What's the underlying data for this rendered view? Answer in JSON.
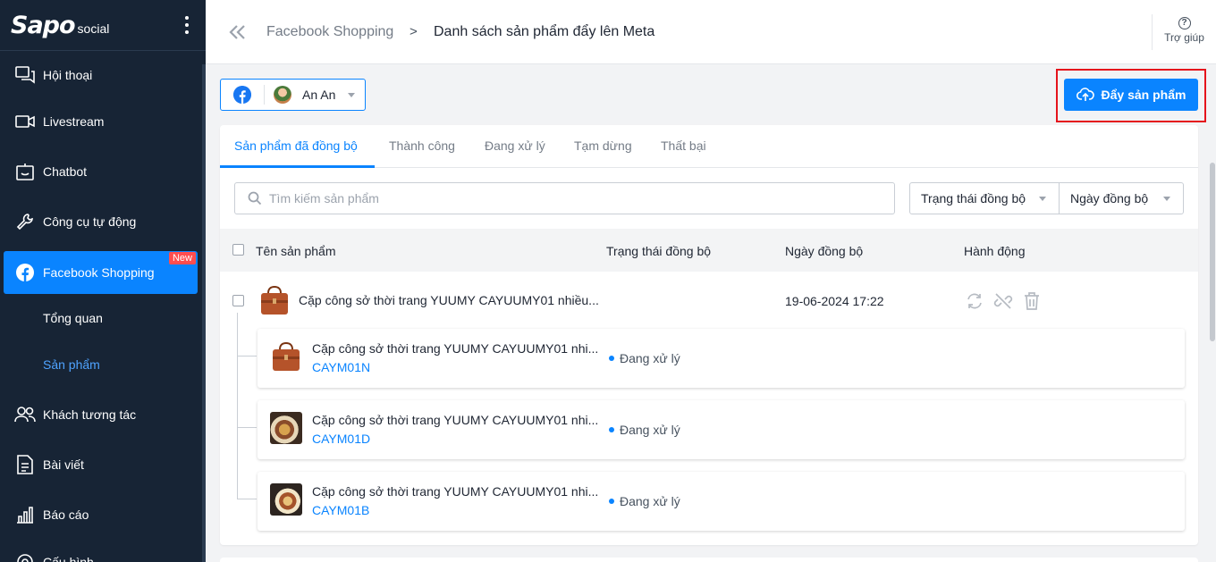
{
  "brand": {
    "logo": "Sapo",
    "sub": "social"
  },
  "sidebar": {
    "items": [
      {
        "label": "Hội thoại",
        "icon": "chat-icon"
      },
      {
        "label": "Livestream",
        "icon": "video-camera-icon"
      },
      {
        "label": "Chatbot",
        "icon": "bot-icon"
      },
      {
        "label": "Công cụ tự động",
        "icon": "wrench-icon"
      },
      {
        "label": "Facebook Shopping",
        "icon": "facebook-icon",
        "badge": "New"
      },
      {
        "label": "Khách tương tác",
        "icon": "users-icon"
      },
      {
        "label": "Bài viết",
        "icon": "document-icon"
      },
      {
        "label": "Báo cáo",
        "icon": "bar-chart-icon"
      },
      {
        "label": "Cấu hình",
        "icon": "settings-icon"
      }
    ],
    "subitems": [
      {
        "label": "Tổng quan"
      },
      {
        "label": "Sản phẩm"
      }
    ]
  },
  "header": {
    "crumb_parent": "Facebook Shopping",
    "crumb_sep": ">",
    "crumb_current": "Danh sách sản phẩm đẩy lên Meta",
    "help": "Trợ giúp"
  },
  "account": {
    "name": "An An"
  },
  "push_button": "Đẩy sản phẩm",
  "tabs": [
    {
      "label": "Sản phẩm đã đồng bộ"
    },
    {
      "label": "Thành công"
    },
    {
      "label": "Đang xử lý"
    },
    {
      "label": "Tạm dừng"
    },
    {
      "label": "Thất bại"
    }
  ],
  "search": {
    "placeholder": "Tìm kiếm sản phẩm"
  },
  "filters": {
    "status": "Trạng thái đồng bộ",
    "date": "Ngày đồng bộ"
  },
  "table": {
    "columns": {
      "name": "Tên sản phẩm",
      "status": "Trạng thái đồng bộ",
      "date": "Ngày đồng bộ",
      "actions": "Hành động"
    },
    "product": {
      "name": "Cặp công sở thời trang YUUMY CAYUUMY01 nhiều...",
      "date": "19-06-2024 17:22",
      "variants": [
        {
          "name": "Cặp công sở thời trang YUUMY CAYUUMY01 nhi...",
          "sku": "CAYM01N",
          "status": "Đang xử lý"
        },
        {
          "name": "Cặp công sở thời trang YUUMY CAYUUMY01 nhi...",
          "sku": "CAYM01D",
          "status": "Đang xử lý"
        },
        {
          "name": "Cặp công sở thời trang YUUMY CAYUUMY01 nhi...",
          "sku": "CAYM01B",
          "status": "Đang xử lý"
        }
      ]
    }
  }
}
